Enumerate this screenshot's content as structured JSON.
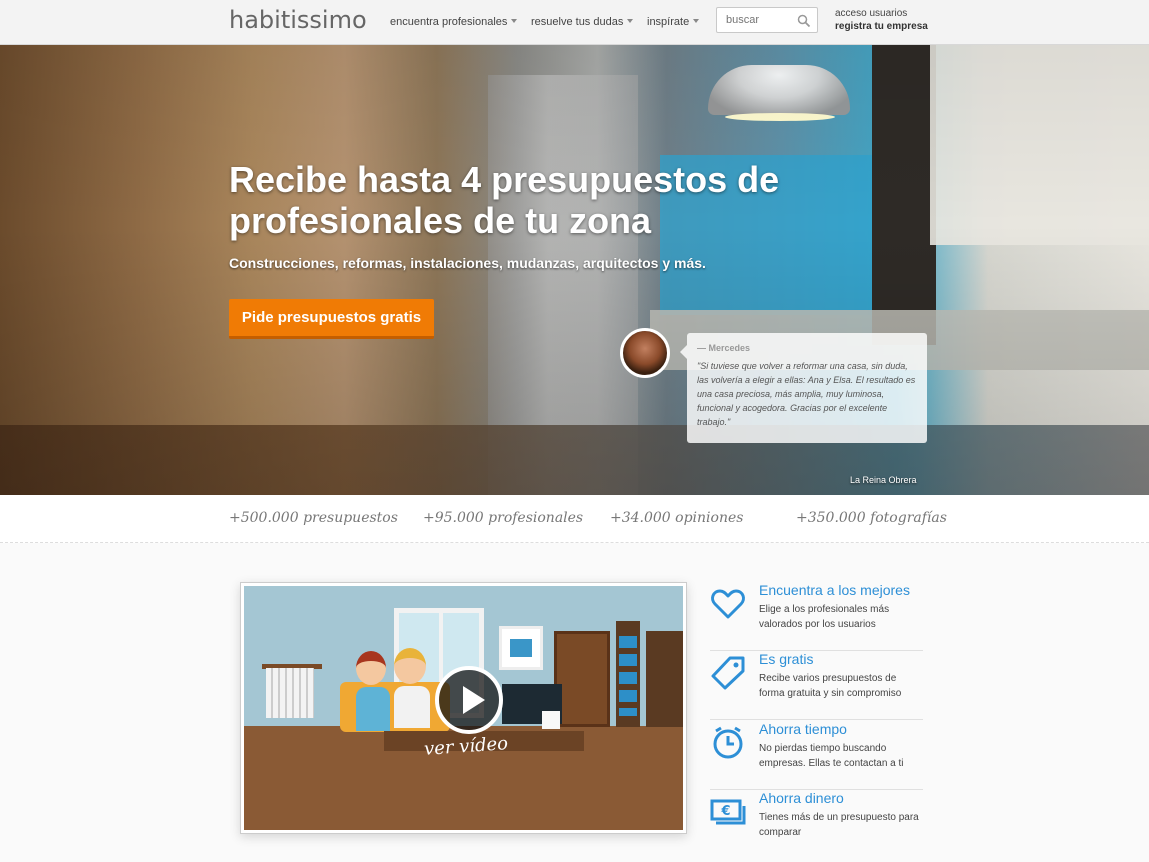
{
  "header": {
    "logo": "habitissimo",
    "nav": [
      {
        "label": "encuentra profesionales"
      },
      {
        "label": "resuelve tus dudas"
      },
      {
        "label": "inspírate"
      }
    ],
    "search": {
      "placeholder": "buscar"
    },
    "user": {
      "login": "acceso usuarios",
      "register": "registra tu empresa"
    }
  },
  "hero": {
    "title": "Recibe hasta 4 presupuestos de profesionales de tu zona",
    "subtitle": "Construcciones, reformas, instalaciones, mudanzas, arquitectos y más.",
    "cta": "Pide presupuestos gratis",
    "testimonial": {
      "author": "— Mercedes",
      "text": "\"Si tuviese que volver a reformar una casa, sin duda, las volvería a elegir a ellas: Ana y Elsa. El resultado es una casa preciosa, más amplia, muy luminosa, funcional y acogedora. Gracias por el excelente trabajo.\""
    },
    "credit": "La Reina Obrera"
  },
  "stats": [
    {
      "label": "+500.000 presupuestos"
    },
    {
      "label": "+95.000 profesionales"
    },
    {
      "label": "+34.000 opiniones"
    },
    {
      "label": "+350.000 fotografías"
    }
  ],
  "video": {
    "label": "ver vídeo"
  },
  "features": [
    {
      "icon": "heart-icon",
      "title": "Encuentra a los mejores",
      "desc": "Elige a los profesionales más valorados por los usuarios"
    },
    {
      "icon": "tag-icon",
      "title": "Es gratis",
      "desc": "Recibe varios presupuestos de forma gratuita y sin compromiso"
    },
    {
      "icon": "clock-icon",
      "title": "Ahorra tiempo",
      "desc": "No pierdas tiempo buscando empresas. Ellas te contactan a ti"
    },
    {
      "icon": "money-icon",
      "title": "Ahorra dinero",
      "desc": "Tienes más de un presupuesto para comparar"
    }
  ],
  "colors": {
    "accent": "#f07b05",
    "link": "#2d8fd6"
  }
}
